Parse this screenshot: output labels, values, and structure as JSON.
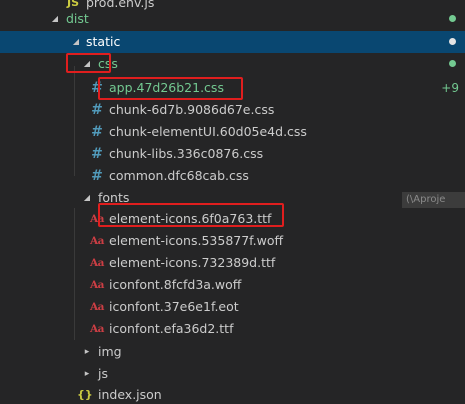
{
  "colors": {
    "background": "#252526",
    "selection": "#094771",
    "git_added": "#73c991",
    "annotation": "#e01e1e"
  },
  "tree": {
    "prod_env": {
      "label": "prod.env.js",
      "icon": "js-icon"
    },
    "dist": {
      "label": "dist",
      "state": "expanded"
    },
    "static": {
      "label": "static",
      "state": "expanded"
    },
    "css": {
      "label": "css",
      "state": "expanded",
      "files": [
        {
          "label": "app.47d26b21.css",
          "icon": "css-icon",
          "badge": "+9"
        },
        {
          "label": "chunk-6d7b.9086d67e.css",
          "icon": "css-icon"
        },
        {
          "label": "chunk-elementUI.60d05e4d.css",
          "icon": "css-icon"
        },
        {
          "label": "chunk-libs.336c0876.css",
          "icon": "css-icon"
        },
        {
          "label": "common.dfc68cab.css",
          "icon": "css-icon"
        }
      ]
    },
    "fonts": {
      "label": "fonts",
      "state": "expanded",
      "files": [
        {
          "label": "element-icons.6f0a763.ttf",
          "icon": "font-icon"
        },
        {
          "label": "element-icons.535877f.woff",
          "icon": "font-icon"
        },
        {
          "label": "element-icons.732389d.ttf",
          "icon": "font-icon"
        },
        {
          "label": "iconfont.8fcfd3a.woff",
          "icon": "font-icon"
        },
        {
          "label": "iconfont.37e6e1f.eot",
          "icon": "font-icon"
        },
        {
          "label": "iconfont.efa36d2.ttf",
          "icon": "font-icon"
        }
      ]
    },
    "img": {
      "label": "img",
      "state": "collapsed"
    },
    "js": {
      "label": "js",
      "state": "collapsed"
    },
    "index_json": {
      "label": "index.json",
      "icon": "json-icon"
    }
  },
  "icons": {
    "css_glyph": "#",
    "font_glyph": "Aa",
    "js_glyph": "JS",
    "json_glyph": "{}"
  },
  "tooltip": {
    "text": "(\\Aproje"
  }
}
